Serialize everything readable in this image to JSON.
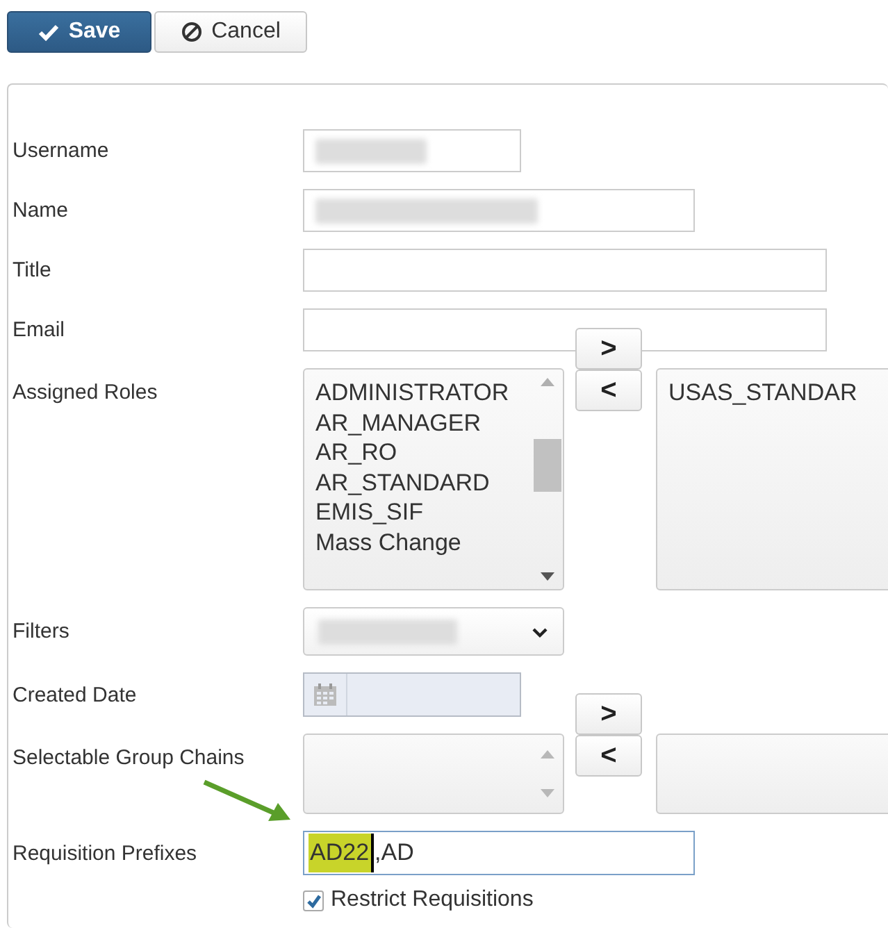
{
  "toolbar": {
    "buttons": [
      {
        "label": "Save",
        "kind": "primary"
      },
      {
        "label": "Cancel",
        "kind": "secondary"
      }
    ]
  },
  "form": {
    "fields": [
      {
        "label": "Username",
        "kind": "text",
        "redacted": true
      },
      {
        "label": "Name",
        "kind": "text",
        "redacted": true
      },
      {
        "label": "Title",
        "kind": "text",
        "redacted": false
      },
      {
        "label": "Email",
        "kind": "text",
        "redacted": false
      },
      {
        "label": "Assigned Roles",
        "kind": "dual_list",
        "available": [
          "ADMINISTRATOR",
          "AR_MANAGER",
          "AR_RO",
          "AR_STANDARD",
          "EMIS_SIF",
          "Mass Change"
        ],
        "assigned": [
          "USAS_STANDAR"
        ],
        "move_buttons": [
          ">",
          "<"
        ]
      },
      {
        "label": "Filters",
        "kind": "select",
        "redacted": true
      },
      {
        "label": "Created Date",
        "kind": "date"
      },
      {
        "label": "Selectable Group Chains",
        "kind": "dual_list",
        "move_buttons": [
          ">",
          "<"
        ]
      },
      {
        "label": "Requisition Prefixes",
        "kind": "prefixes",
        "annotated": true,
        "value_parts": [
          {
            "text": "AD22",
            "highlighted": true
          },
          {
            "text": ",AD",
            "highlighted": false
          }
        ]
      }
    ],
    "checkbox": {
      "label": "Restrict Requisitions",
      "checked": true
    }
  }
}
